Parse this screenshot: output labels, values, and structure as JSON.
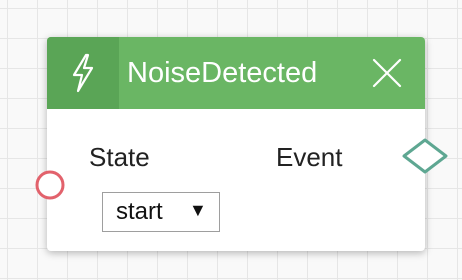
{
  "node": {
    "title": "NoiseDetected",
    "icon": "lightning-bolt-icon",
    "close_icon": "close-icon",
    "input": {
      "label": "State",
      "select_value": "start",
      "select_arrow": "▼"
    },
    "output": {
      "label": "Event"
    }
  },
  "colors": {
    "header": "#6ab664",
    "icon_box": "#5aa556",
    "input_port": "#e2626c",
    "output_port": "#5ea792"
  }
}
